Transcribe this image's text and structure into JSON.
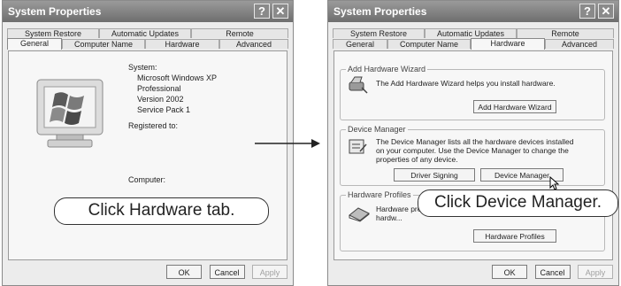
{
  "left_window": {
    "title": "System Properties",
    "help_glyph": "?",
    "close_glyph": "✕",
    "tabs_row1": [
      "System Restore",
      "Automatic Updates",
      "Remote"
    ],
    "tabs_row2": [
      "General",
      "Computer Name",
      "Hardware",
      "Advanced"
    ],
    "selected_tab": "General",
    "system_label": "System:",
    "system_lines": [
      "Microsoft Windows XP",
      "Professional",
      "Version 2002",
      "Service Pack 1"
    ],
    "registered_label": "Registered to:",
    "computer_label": "Computer:",
    "buttons": {
      "ok": "OK",
      "cancel": "Cancel",
      "apply": "Apply"
    }
  },
  "right_window": {
    "title": "System Properties",
    "help_glyph": "?",
    "close_glyph": "✕",
    "tabs_row1": [
      "System Restore",
      "Automatic Updates",
      "Remote"
    ],
    "tabs_row2": [
      "General",
      "Computer Name",
      "Hardware",
      "Advanced"
    ],
    "selected_tab": "Hardware",
    "wizard": {
      "title": "Add Hardware Wizard",
      "text": "The Add Hardware Wizard helps you install hardware.",
      "button": "Add Hardware Wizard"
    },
    "device_manager": {
      "title": "Device Manager",
      "text": "The Device Manager lists all the hardware devices installed on your computer. Use the Device Manager to change the properties of any device.",
      "signing_button": "Driver Signing",
      "button": "Device Manager"
    },
    "profiles": {
      "title": "Hardware Profiles",
      "text": "Hardware pro... different hardw...",
      "button": "Hardware Profiles"
    },
    "buttons": {
      "ok": "OK",
      "cancel": "Cancel",
      "apply": "Apply"
    }
  },
  "callouts": {
    "left": "Click Hardware tab.",
    "right": "Click Device Manager."
  }
}
